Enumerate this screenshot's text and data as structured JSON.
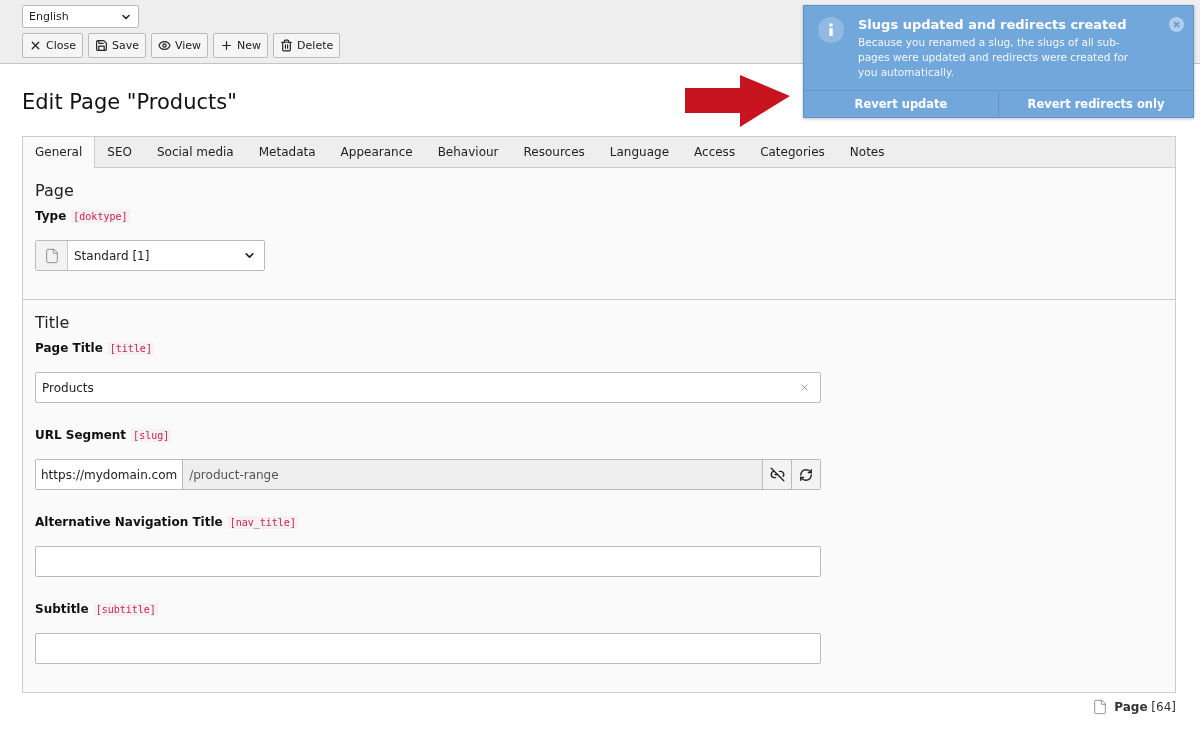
{
  "toolbar": {
    "language": "English",
    "buttons": [
      {
        "kind": "close",
        "label": "Close"
      },
      {
        "kind": "save",
        "label": "Save"
      },
      {
        "kind": "view",
        "label": "View"
      },
      {
        "kind": "new",
        "label": "New"
      },
      {
        "kind": "delete",
        "label": "Delete"
      }
    ]
  },
  "page_title": "Edit Page \"Products\"",
  "tabs": [
    {
      "label": "General",
      "selected": true
    },
    {
      "label": "SEO",
      "selected": false
    },
    {
      "label": "Social media",
      "selected": false
    },
    {
      "label": "Metadata",
      "selected": false
    },
    {
      "label": "Appearance",
      "selected": false
    },
    {
      "label": "Behaviour",
      "selected": false
    },
    {
      "label": "Resources",
      "selected": false
    },
    {
      "label": "Language",
      "selected": false
    },
    {
      "label": "Access",
      "selected": false
    },
    {
      "label": "Categories",
      "selected": false
    },
    {
      "label": "Notes",
      "selected": false
    }
  ],
  "sections": [
    {
      "heading": "Page",
      "fields": [
        {
          "kind": "select",
          "label": "Type",
          "field_name": "[doktype]",
          "value": "Standard [1]"
        }
      ]
    },
    {
      "heading": "Title",
      "fields": [
        {
          "kind": "text",
          "label": "Page Title",
          "field_name": "[title]",
          "value": "Products",
          "clearable": true
        },
        {
          "kind": "slug",
          "label": "URL Segment",
          "field_name": "[slug]",
          "prefix": "https://mydomain.com",
          "value": "/product-range"
        },
        {
          "kind": "text",
          "label": "Alternative Navigation Title",
          "field_name": "[nav_title]",
          "clearable": false
        },
        {
          "kind": "text",
          "label": "Subtitle",
          "field_name": "[subtitle]",
          "clearable": false
        }
      ]
    }
  ],
  "footer": {
    "record": "**Page** [64]"
  },
  "notification": {
    "title": "Slugs updated and redirects created",
    "message": "Because you renamed a slug, the slugs of all sub-pages were updated and redirects were created for you automatically.",
    "actions": [
      "Revert update",
      "Revert redirects only"
    ]
  }
}
